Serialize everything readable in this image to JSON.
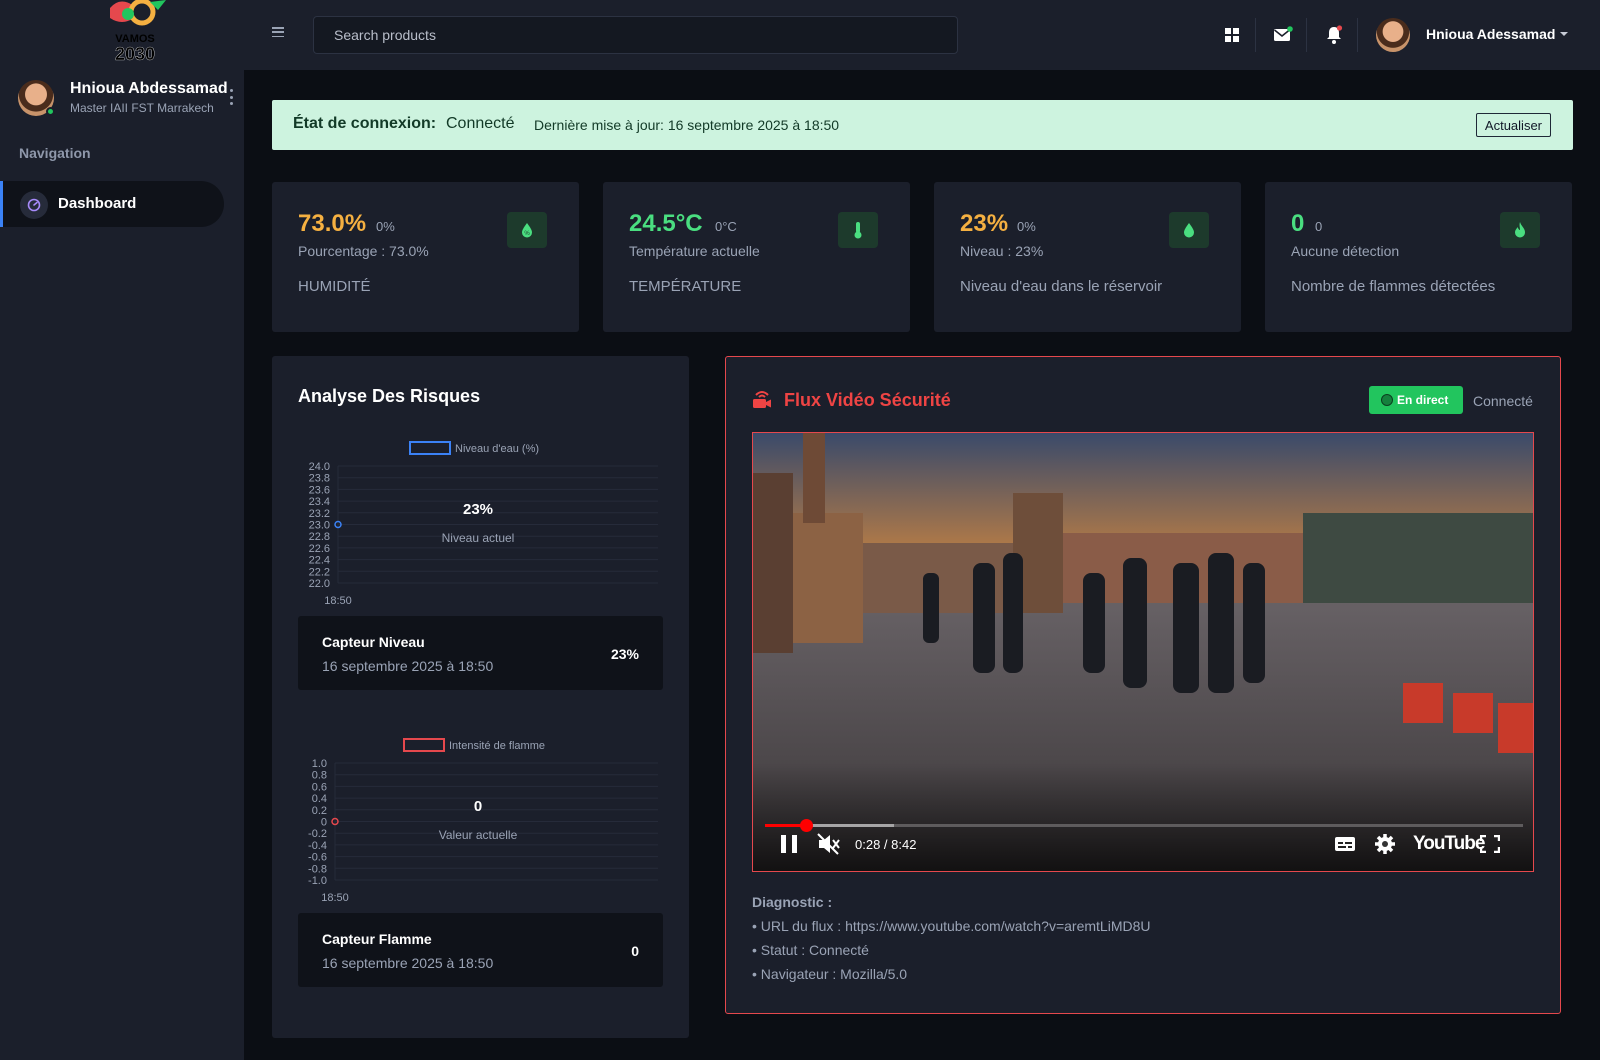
{
  "sidebar": {
    "user": {
      "name": "Hnioua Abdessamad",
      "subtitle": "Master IAII FST Marrakech"
    },
    "nav_title": "Navigation",
    "items": [
      {
        "label": "Dashboard",
        "icon": "dashboard-gauge-icon",
        "active": true
      }
    ]
  },
  "topbar": {
    "search_placeholder": "Search products",
    "user_name": "Hnioua Adessamad",
    "icons": [
      "apps-grid-icon",
      "mail-icon",
      "bell-icon"
    ]
  },
  "connection": {
    "label": "État de connexion:",
    "status": "Connecté",
    "last_update": "Dernière mise à jour: 16 septembre 2025 à 18:50",
    "refresh_label": "Actualiser"
  },
  "cards": [
    {
      "value": "73.0%",
      "delta": "0%",
      "sub": "Pourcentage : 73.0%",
      "label": "HUMIDITÉ",
      "value_color": "#f5b041",
      "icon": "humidity-drop-icon"
    },
    {
      "value": "24.5°C",
      "delta": "0°C",
      "sub": "Température actuelle",
      "label": "TEMPÉRATURE",
      "value_color": "#4ade80",
      "icon": "thermometer-icon"
    },
    {
      "value": "23%",
      "delta": "0%",
      "sub": "Niveau : 23%",
      "label": "Niveau d'eau dans le réservoir",
      "value_color": "#f5b041",
      "icon": "water-drop-icon"
    },
    {
      "value": "0",
      "delta": "0",
      "sub": "Aucune détection",
      "label": "Nombre de flammes détectées",
      "value_color": "#4ade80",
      "icon": "flame-icon"
    }
  ],
  "risk": {
    "title": "Analyse Des Risques",
    "water_chart_center_value": "23%",
    "water_chart_center_label": "Niveau actuel",
    "flame_chart_center_value": "0",
    "flame_chart_center_label": "Valeur actuelle",
    "sensors": [
      {
        "title": "Capteur Niveau",
        "date": "16 septembre 2025 à 18:50",
        "value": "23%"
      },
      {
        "title": "Capteur Flamme",
        "date": "16 septembre 2025 à 18:50",
        "value": "0"
      }
    ]
  },
  "chart_data": [
    {
      "type": "line",
      "series": [
        {
          "name": "Niveau d'eau (%)",
          "x": [
            "18:50"
          ],
          "values": [
            23.0
          ]
        }
      ],
      "x": [
        "18:50"
      ],
      "ylim": [
        22.0,
        24.0
      ],
      "yticks": [
        "24.0",
        "23.8",
        "23.6",
        "23.4",
        "23.2",
        "23.0",
        "22.8",
        "22.6",
        "22.4",
        "22.2",
        "22.0"
      ],
      "color": "#3b82f6",
      "grid": true,
      "legend": "top-center"
    },
    {
      "type": "line",
      "series": [
        {
          "name": "Intensité de flamme",
          "x": [
            "18:50"
          ],
          "values": [
            0
          ]
        }
      ],
      "x": [
        "18:50"
      ],
      "ylim": [
        -1.0,
        1.0
      ],
      "yticks": [
        "1.0",
        "0.8",
        "0.6",
        "0.4",
        "0.2",
        "0",
        "-0.2",
        "-0.4",
        "-0.6",
        "-0.8",
        "-1.0"
      ],
      "color": "#e5484d",
      "grid": true,
      "legend": "top-center"
    }
  ],
  "video": {
    "title": "Flux Vidéo Sécurité",
    "live_label": "En direct",
    "status": "Connecté",
    "time": "0:28 / 8:42",
    "progress": 0.054,
    "buffered": 0.17,
    "brand": "YouTube",
    "diagnostic_title": "Diagnostic :",
    "diagnostic_lines": [
      "• URL du flux : https://www.youtube.com/watch?v=aremtLiMD8U",
      "• Statut : Connecté",
      "• Navigateur : Mozilla/5.0"
    ]
  }
}
